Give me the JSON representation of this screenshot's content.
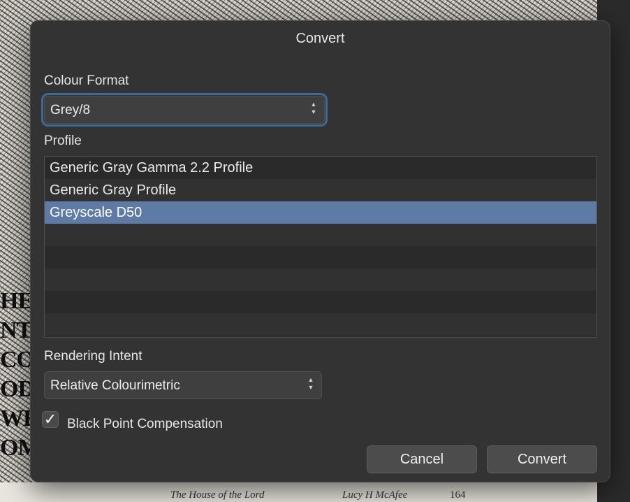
{
  "dialog": {
    "title": "Convert",
    "colour_format": {
      "label": "Colour Format",
      "selected": "Grey/8"
    },
    "profile": {
      "label": "Profile",
      "items": [
        {
          "label": "Generic Gray Gamma 2.2 Profile",
          "selected": false
        },
        {
          "label": "Generic Gray Profile",
          "selected": false
        },
        {
          "label": "Greyscale D50",
          "selected": true
        }
      ]
    },
    "rendering_intent": {
      "label": "Rendering Intent",
      "selected": "Relative Colourimetric"
    },
    "black_point": {
      "label": "Black Point Compensation",
      "checked": true
    },
    "buttons": {
      "cancel": "Cancel",
      "convert": "Convert"
    }
  },
  "background": {
    "caption_left": "The House of the Lord",
    "caption_right": "Lucy H  McAfee",
    "page_number": "164",
    "side_letters": [
      "HE",
      "NTH",
      "CON",
      "OD",
      "WE",
      "OM"
    ]
  },
  "colors": {
    "dialog_bg": "#333333",
    "selection": "#5d7ba5",
    "focus_ring": "#3d6a96"
  }
}
